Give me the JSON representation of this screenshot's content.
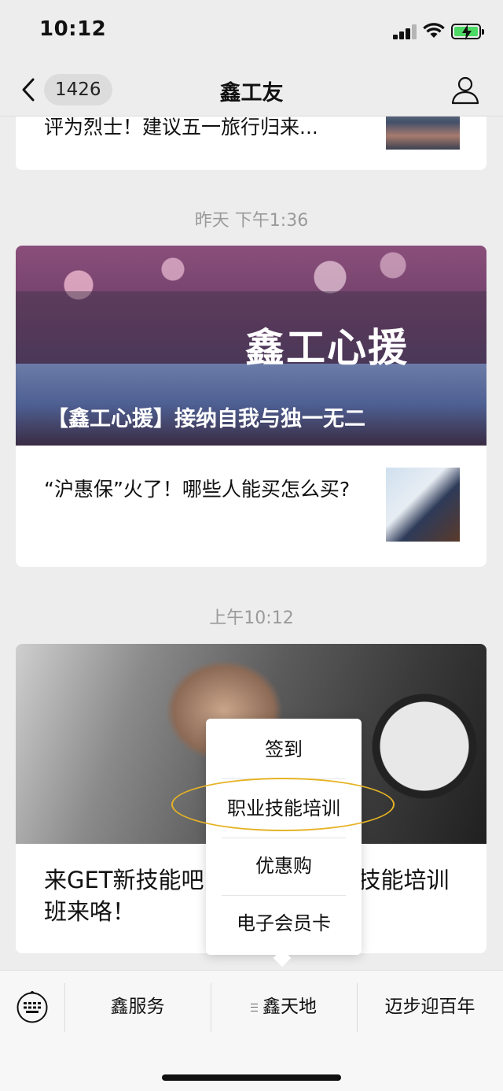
{
  "status": {
    "time": "10:12"
  },
  "nav": {
    "badge": "1426",
    "title": "鑫工友"
  },
  "feed": {
    "card_a": {
      "title": "评为烈士！建议五一旅行归来..."
    },
    "timestamp_1": "昨天 下午1:36",
    "card_b": {
      "hero_text": "鑫工心援",
      "hero_caption": "【鑫工心援】接纳自我与独一无二",
      "item_title": "“沪惠保”火了！哪些人能买怎么买?"
    },
    "timestamp_2": "上午10:12",
    "card_c": {
      "title_left": "来GET新技能吧",
      "title_right": "技能培训",
      "title_line2": "班来咯！"
    }
  },
  "popup_menu": {
    "items": [
      "签到",
      "职业技能培训",
      "优惠购",
      "电子会员卡"
    ],
    "highlighted_index": 1,
    "highlight_color": "#e6b325"
  },
  "bottom_menu": {
    "tabs": [
      "鑫服务",
      "鑫天地",
      "迈步迎百年"
    ],
    "active_tab": "鑫天地"
  }
}
